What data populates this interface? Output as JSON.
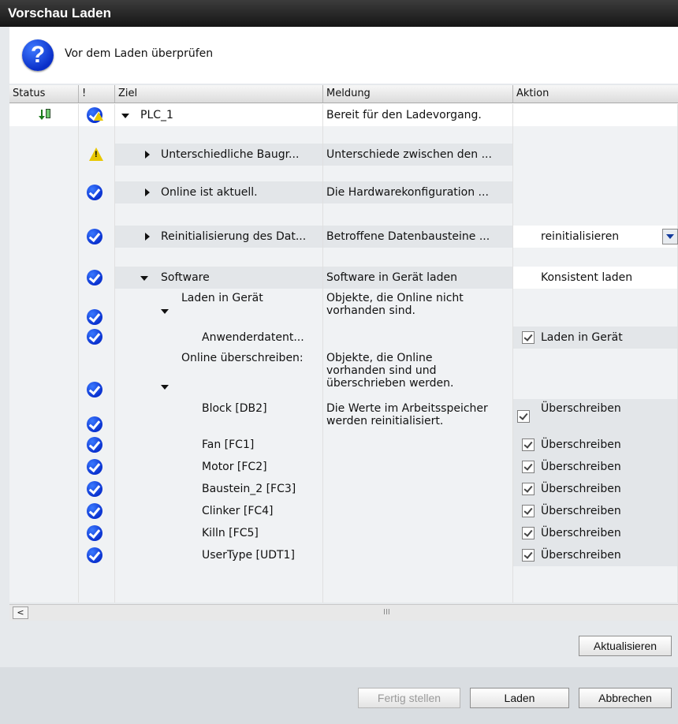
{
  "window": {
    "title": "Vorschau Laden"
  },
  "header": {
    "icon": "question-icon",
    "icon_glyph": "?",
    "text": "Vor dem Laden überprüfen"
  },
  "columns": [
    "Status",
    "!",
    "Ziel",
    "Meldung",
    "Aktion"
  ],
  "rows": {
    "plc": {
      "target": "PLC_1",
      "message": "Bereit für den Ladevorgang."
    },
    "baugruppen": {
      "target": "Unterschiedliche Baugr...",
      "message": "Unterschiede zwischen den ..."
    },
    "online": {
      "target": "Online ist aktuell.",
      "message": "Die Hardwarekonfiguration ..."
    },
    "reinit": {
      "target": "Reinitialisierung des Dat...",
      "message": "Betroffene Datenbausteine ...",
      "action": "reinitialisieren"
    },
    "software": {
      "target": "Software",
      "message": "Software in Gerät laden",
      "action": "Konsistent laden"
    },
    "laden_geraet": {
      "target": "Laden in Gerät",
      "message": "Objekte, die Online nicht vorhanden sind."
    },
    "anwenderdaten": {
      "target": "Anwenderdatent...",
      "action": "Laden in Gerät"
    },
    "online_ueber": {
      "target": "Online überschreiben:",
      "message": "Objekte, die Online vorhanden sind und überschrieben werden."
    },
    "block": {
      "target": "Block [DB2]",
      "message": "Die Werte im Arbeitsspeicher werden reinitialisiert.",
      "action": "Überschreiben"
    },
    "fan": {
      "target": "Fan [FC1]",
      "action": "Überschreiben"
    },
    "motor": {
      "target": "Motor [FC2]",
      "action": "Überschreiben"
    },
    "baustein": {
      "target": "Baustein_2 [FC3]",
      "action": "Überschreiben"
    },
    "clinker": {
      "target": "Clinker [FC4]",
      "action": "Überschreiben"
    },
    "killn": {
      "target": "Killn [FC5]",
      "action": "Überschreiben"
    },
    "usertype": {
      "target": "UserType [UDT1]",
      "action": "Überschreiben"
    }
  },
  "scrollbar": {
    "left_glyph": "<",
    "thumb_glyph": "III"
  },
  "buttons": {
    "refresh": "Aktualisieren",
    "finish": "Fertig stellen",
    "load": "Laden",
    "cancel": "Abbrechen"
  },
  "colors": {
    "accent_blue": "#0a32d0",
    "warning_yellow": "#e8c700",
    "titlebar": "#151515"
  }
}
